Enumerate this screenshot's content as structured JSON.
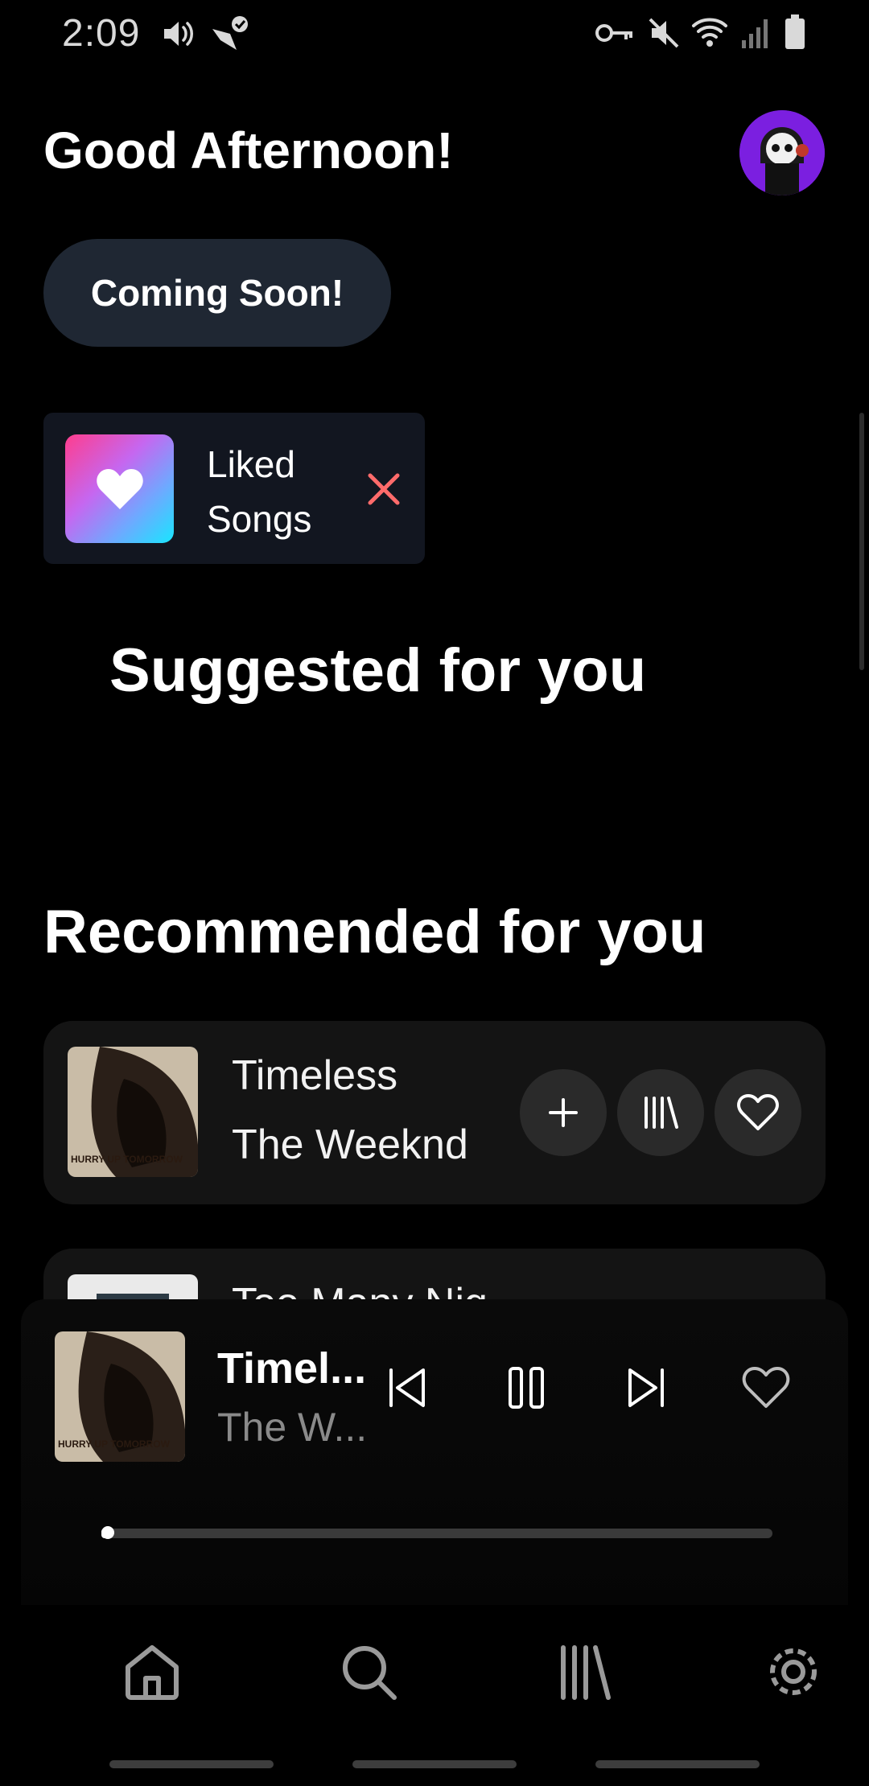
{
  "status_bar": {
    "time": "2:09",
    "icons": [
      "volume-icon",
      "checkmark-bird-icon",
      "vpn-key-icon",
      "mute-icon",
      "wifi-icon",
      "signal-icon",
      "battery-icon"
    ]
  },
  "header": {
    "greeting": "Good Afternoon!",
    "avatar": "skull-avatar"
  },
  "coming_soon": {
    "label": "Coming Soon!"
  },
  "liked_songs": {
    "label": "Liked Songs",
    "icon": "heart-icon",
    "close_icon": "close-icon"
  },
  "sections": {
    "suggested": "Suggested for you",
    "recommended": "Recommended for you"
  },
  "tracks": [
    {
      "title": "Timeless",
      "artist": "The Weeknd",
      "cover_text": "HURRY UP TOMORROW"
    },
    {
      "title": "Too Many Nig",
      "artist": "",
      "cover_text": ""
    }
  ],
  "now_playing": {
    "title": "Timel...",
    "artist": "The W...",
    "cover_text": "HURRY UP TOMORROW",
    "progress": 0.01
  },
  "nav": {
    "items": [
      "home-icon",
      "search-icon",
      "library-icon",
      "settings-icon"
    ]
  },
  "colors": {
    "background": "#000000",
    "pill": "#1f2733",
    "card": "#121620",
    "row": "#141414",
    "button": "#2a2a2a",
    "close": "#ff6b6b",
    "avatar": "#7b1fe0"
  }
}
